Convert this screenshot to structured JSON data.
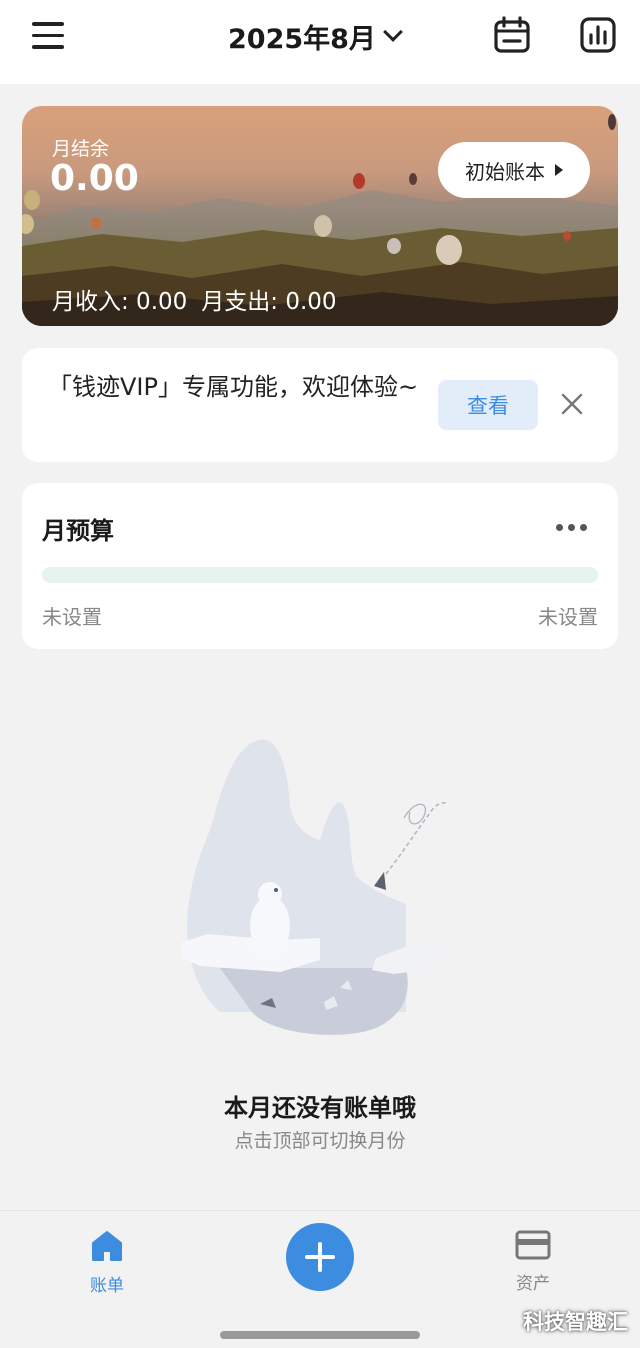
{
  "header": {
    "month": "2025年8月",
    "menu_icon": "hamburger-menu-icon",
    "calendar_icon": "calendar-icon",
    "stats_icon": "bar-chart-icon"
  },
  "summary": {
    "balance_label": "月结余",
    "balance_value": "0.00",
    "initial_book_label": "初始账本",
    "income_text": "月收入: 0.00",
    "expense_text": "月支出: 0.00"
  },
  "vip": {
    "text": "「钱迹VIP」专属功能，欢迎体验~",
    "view_label": "查看",
    "close_icon": "close-icon"
  },
  "budget": {
    "title": "月预算",
    "left_status": "未设置",
    "right_status": "未设置",
    "progress": 0
  },
  "empty_state": {
    "title": "本月还没有账单哦",
    "subtitle": "点击顶部可切换月份",
    "illustration": "polar-bear-iceberg-illustration"
  },
  "tabbar": {
    "ledger_label": "账单",
    "assets_label": "资产",
    "add_icon": "plus-icon"
  },
  "watermark": "科技智趣汇",
  "colors": {
    "accent": "#3c8ce0",
    "background": "#f2f2f2",
    "progress_track": "#e6f3ef"
  }
}
